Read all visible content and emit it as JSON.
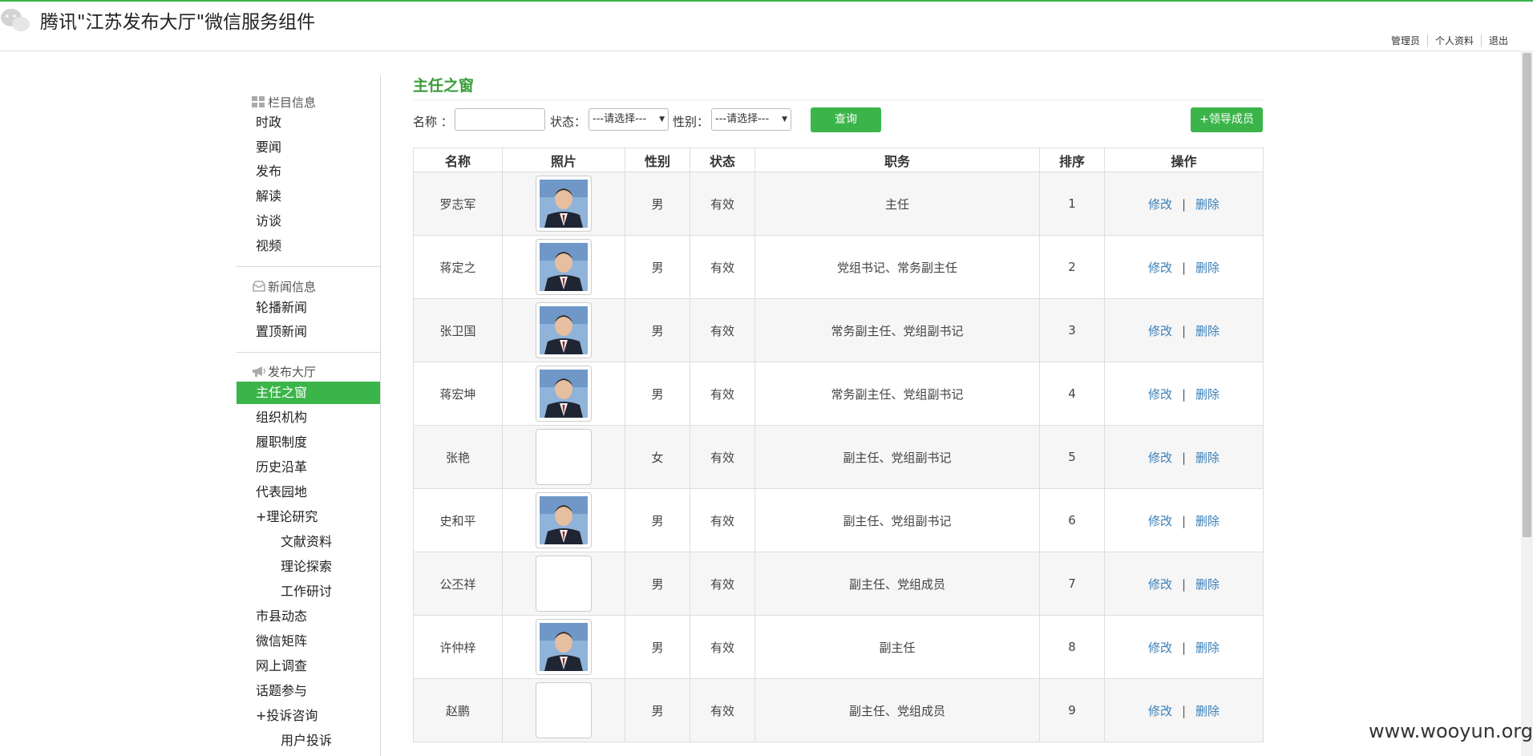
{
  "app": {
    "title": "腾讯\"江苏发布大厅\"微信服务组件",
    "top_links": [
      "管理员",
      "个人资料",
      "退出"
    ],
    "brand_color": "#3bb54a"
  },
  "sidebar": {
    "sections": [
      {
        "icon": "grid-icon",
        "title": "栏目信息",
        "items": [
          "时政",
          "要闻",
          "发布",
          "解读",
          "访谈",
          "视频"
        ]
      },
      {
        "icon": "inbox-icon",
        "title": "新闻信息",
        "items": [
          "轮播新闻",
          "置顶新闻"
        ]
      },
      {
        "icon": "megaphone-icon",
        "title": "发布大厅",
        "items": [
          "主任之窗",
          "组织机构",
          "履职制度",
          "历史沿革",
          "代表园地",
          "+理论研究",
          "文献资料",
          "理论探索",
          "工作研讨",
          "市县动态",
          "微信矩阵",
          "网上调查",
          "话题参与",
          "+投诉咨询",
          "用户投诉"
        ]
      }
    ],
    "active_item": "主任之窗"
  },
  "main": {
    "title": "主任之窗",
    "filter": {
      "name_label": "名称 ：",
      "name_value": "",
      "status_label": "状态：",
      "status_value": "---请选择---",
      "gender_label": "性别：",
      "gender_value": "---请选择---",
      "query_label": "查询",
      "add_label": "+领导成员"
    },
    "table": {
      "headers": [
        "名称",
        "照片",
        "性别",
        "状态",
        "职务",
        "排序",
        "操作"
      ],
      "edit_label": "修改",
      "delete_label": "删除",
      "divider": "|",
      "rows": [
        {
          "name": "罗志军",
          "has_photo": true,
          "gender": "男",
          "status": "有效",
          "post": "主任",
          "order": "1"
        },
        {
          "name": "蒋定之",
          "has_photo": true,
          "gender": "男",
          "status": "有效",
          "post": "党组书记、常务副主任",
          "order": "2"
        },
        {
          "name": "张卫国",
          "has_photo": true,
          "gender": "男",
          "status": "有效",
          "post": "常务副主任、党组副书记",
          "order": "3"
        },
        {
          "name": "蒋宏坤",
          "has_photo": true,
          "gender": "男",
          "status": "有效",
          "post": "常务副主任、党组副书记",
          "order": "4"
        },
        {
          "name": "张艳",
          "has_photo": false,
          "gender": "女",
          "status": "有效",
          "post": "副主任、党组副书记",
          "order": "5"
        },
        {
          "name": "史和平",
          "has_photo": true,
          "gender": "男",
          "status": "有效",
          "post": "副主任、党组副书记",
          "order": "6"
        },
        {
          "name": "公丕祥",
          "has_photo": false,
          "gender": "男",
          "status": "有效",
          "post": "副主任、党组成员",
          "order": "7"
        },
        {
          "name": "许仲梓",
          "has_photo": true,
          "gender": "男",
          "status": "有效",
          "post": "副主任",
          "order": "8"
        },
        {
          "name": "赵鹏",
          "has_photo": false,
          "gender": "男",
          "status": "有效",
          "post": "副主任、党组成员",
          "order": "9"
        }
      ]
    }
  },
  "watermark": "www.wooyun.org"
}
